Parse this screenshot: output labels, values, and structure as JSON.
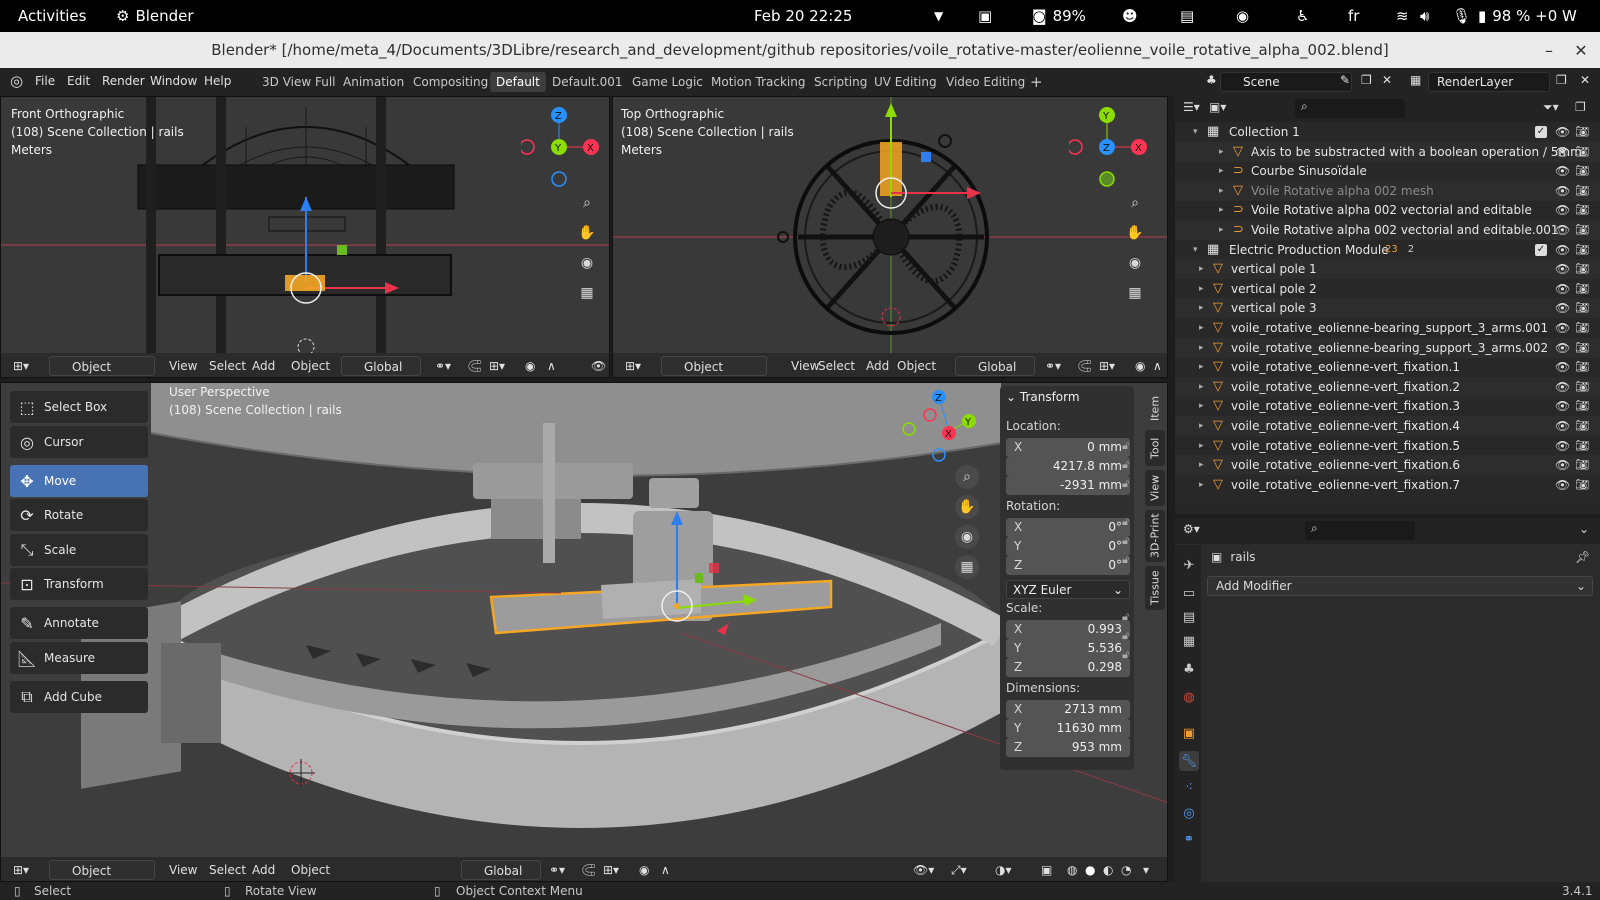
{
  "system_bar": {
    "activities": "Activities",
    "app": "Blender",
    "datetime": "Feb 20  22:25",
    "battery_widget": "89%",
    "language": "fr",
    "power": "98 % +0 W"
  },
  "window": {
    "title": "Blender* [/home/meta_4/Documents/3DLibre/research_and_development/github repositories/voile_rotative-master/eolienne_voile_rotative_alpha_002.blend]"
  },
  "menu": [
    "File",
    "Edit",
    "Render",
    "Window",
    "Help"
  ],
  "workspaces": [
    "3D View Full",
    "Animation",
    "Compositing",
    "Default",
    "Default.001",
    "Game Logic",
    "Motion Tracking",
    "Scripting",
    "UV Editing",
    "Video Editing"
  ],
  "active_workspace": "Default",
  "scene": "Scene",
  "view_layer": "RenderLayer",
  "vp_front": {
    "l1": "Front Orthographic",
    "l2": "(108) Scene Collection | rails",
    "l3": "Meters"
  },
  "vp_top": {
    "l1": "Top Orthographic",
    "l2": "(108) Scene Collection | rails",
    "l3": "Meters"
  },
  "vp_persp": {
    "l1": "User Perspective",
    "l2": "(108) Scene Collection | rails"
  },
  "vheader": {
    "mode": "Object Mode",
    "view": "View",
    "select": "Select",
    "add": "Add",
    "object": "Object",
    "orient": "Global"
  },
  "gizmo": {
    "x": "X",
    "y": "Y",
    "z": "Z"
  },
  "tools": [
    "Select Box",
    "Cursor",
    "Move",
    "Rotate",
    "Scale",
    "Transform",
    "Annotate",
    "Measure",
    "Add Cube"
  ],
  "npanel": {
    "title": "Transform",
    "location_label": "Location:",
    "loc": [
      "0 mm",
      "4217.8 mm",
      "-2931 mm"
    ],
    "rotation_label": "Rotation:",
    "rot": [
      "0°",
      "0°",
      "0°"
    ],
    "rotation_mode": "XYZ Euler",
    "scale_label": "Scale:",
    "scale": [
      "0.993",
      "5.536",
      "0.298"
    ],
    "dim_label": "Dimensions:",
    "dim": [
      "2713 mm",
      "11630 mm",
      "953 mm"
    ]
  },
  "side_tabs": [
    "Item",
    "Tool",
    "View",
    "3D-Print",
    "Tissue"
  ],
  "outliner": [
    {
      "name": "Collection 1",
      "type": "collection",
      "indent": 0
    },
    {
      "name": "Axis to be substracted with a boolean operation / 5mm",
      "type": "mesh",
      "indent": 1
    },
    {
      "name": "Courbe Sinusoïdale",
      "type": "curve",
      "indent": 1
    },
    {
      "name": "Voile Rotative alpha 002 mesh",
      "type": "mesh",
      "indent": 1
    },
    {
      "name": "Voile Rotative alpha 002 vectorial and editable",
      "type": "curve",
      "indent": 1
    },
    {
      "name": "Voile Rotative alpha 002 vectorial and editable.001",
      "type": "curve",
      "indent": 1
    },
    {
      "name": "Electric Production Module",
      "type": "collection",
      "indent": 0
    },
    {
      "name": "vertical pole 1",
      "type": "mesh",
      "indent": 0
    },
    {
      "name": "vertical pole 2",
      "type": "mesh",
      "indent": 0
    },
    {
      "name": "vertical pole 3",
      "type": "mesh",
      "indent": 0
    },
    {
      "name": "voile_rotative_eolienne-bearing_support_3_arms.001",
      "type": "mesh",
      "indent": 0
    },
    {
      "name": "voile_rotative_eolienne-bearing_support_3_arms.002",
      "type": "mesh",
      "indent": 0
    },
    {
      "name": "voile_rotative_eolienne-vert_fixation.1",
      "type": "mesh",
      "indent": 0
    },
    {
      "name": "voile_rotative_eolienne-vert_fixation.2",
      "type": "mesh",
      "indent": 0
    },
    {
      "name": "voile_rotative_eolienne-vert_fixation.3",
      "type": "mesh",
      "indent": 0
    },
    {
      "name": "voile_rotative_eolienne-vert_fixation.4",
      "type": "mesh",
      "indent": 0
    },
    {
      "name": "voile_rotative_eolienne-vert_fixation.5",
      "type": "mesh",
      "indent": 0
    },
    {
      "name": "voile_rotative_eolienne-vert_fixation.6",
      "type": "mesh",
      "indent": 0
    },
    {
      "name": "voile_rotative_eolienne-vert_fixation.7",
      "type": "mesh",
      "indent": 0
    }
  ],
  "outliner_badges": {
    "epm_count_a": "23",
    "epm_count_b": "2"
  },
  "properties": {
    "object": "rails",
    "add_modifier": "Add Modifier"
  },
  "status": {
    "select": "Select",
    "rotate": "Rotate View",
    "context": "Object Context Menu",
    "version": "3.4.1"
  },
  "colors": {
    "accent": "#4772b3",
    "selection": "#f5a623",
    "axis_x": "#ff3352",
    "axis_y": "#8bdc00",
    "axis_z": "#2890ff"
  }
}
